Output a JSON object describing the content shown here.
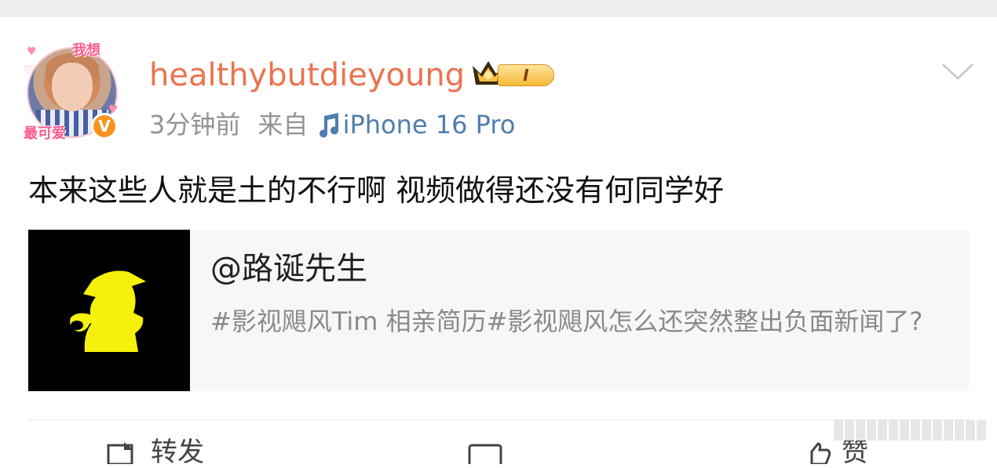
{
  "post": {
    "username": "healthybutdieyoung",
    "vip_level": "I",
    "time": "3分钟前",
    "source_prefix": "来自",
    "device": "iPhone 16 Pro",
    "content": "本来这些人就是土的不行啊 视频做得还没有何同学好",
    "avatar_sticker_top": "我想",
    "avatar_sticker_bottom": "最可爱",
    "verified_mark": "V"
  },
  "linked_card": {
    "title": "@路诞先生",
    "description": "#影视飓风Tim 相亲简历#影视飓风怎么还突然整出负面新闻了?"
  },
  "actions": {
    "repost": "转发",
    "comment": "",
    "like": "赞"
  },
  "colors": {
    "username": "#eb7350",
    "device_link": "#507daf",
    "meta_gray": "#939393",
    "card_bg": "#f7f7f7",
    "thumb_figure": "#f5f10a"
  },
  "icons": {
    "crown": "crown-icon",
    "music_note": "music-note-icon",
    "dropdown": "chevron-down-icon",
    "verified": "verified-icon"
  }
}
